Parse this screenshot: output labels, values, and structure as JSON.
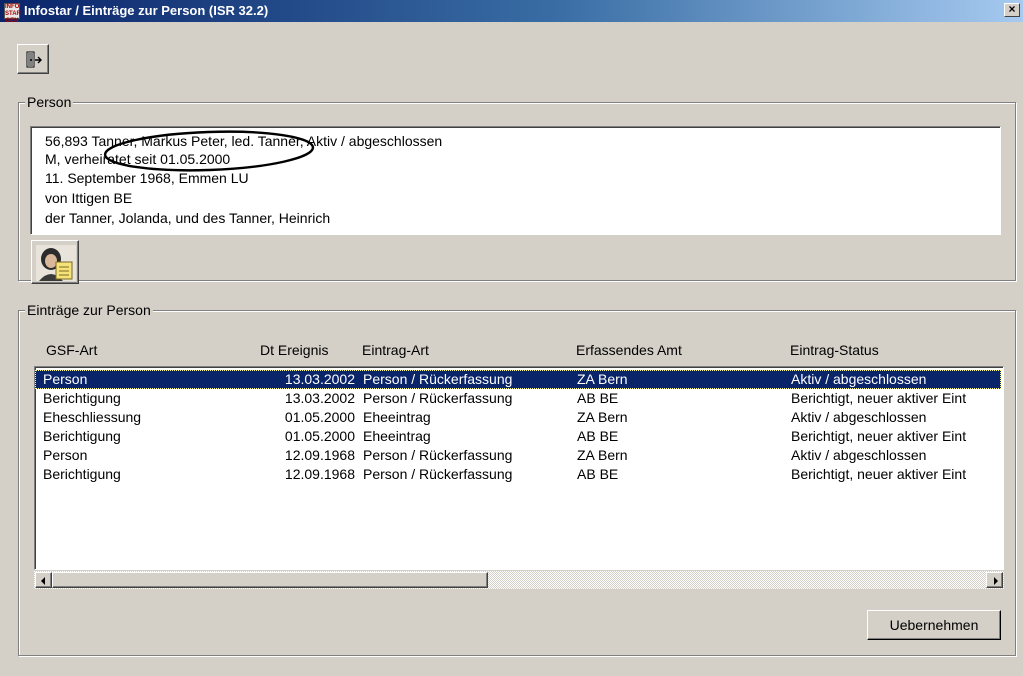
{
  "window": {
    "title": "Infostar / Einträge zur Person (ISR 32.2)",
    "icon_lines": [
      "INFO",
      "STAR",
      "GEN"
    ],
    "close_label": "×"
  },
  "toolbar": {
    "exit_icon": "door-exit-icon"
  },
  "person": {
    "group_label": "Person",
    "lines": [
      "56,893 Tanner, Markus Peter, led. Tanner, Aktiv / abgeschlossen",
      "M, verheiratet seit 01.05.2000",
      "11. September 1968, Emmen LU",
      "von Ittigen BE",
      "der Tanner, Jolanda, und des Tanner, Heinrich"
    ],
    "photo_icon": "person-photo-icon"
  },
  "eintraege": {
    "group_label": "Einträge zur Person",
    "columns": [
      "GSF-Art",
      "Dt Ereignis",
      "Eintrag-Art",
      "Erfassendes Amt",
      "Eintrag-Status"
    ],
    "rows": [
      [
        "Person",
        "13.03.2002",
        "Person / Rückerfassung",
        "ZA Bern",
        "Aktiv / abgeschlossen"
      ],
      [
        "Berichtigung",
        "13.03.2002",
        "Person / Rückerfassung",
        "AB BE",
        "Berichtigt, neuer aktiver Eint"
      ],
      [
        "Eheschliessung",
        "01.05.2000",
        "Eheeintrag",
        "ZA Bern",
        "Aktiv / abgeschlossen"
      ],
      [
        "Berichtigung",
        "01.05.2000",
        "Eheeintrag",
        "AB BE",
        "Berichtigt, neuer aktiver Eint"
      ],
      [
        "Person",
        "12.09.1968",
        "Person / Rückerfassung",
        "ZA Bern",
        "Aktiv / abgeschlossen"
      ],
      [
        "Berichtigung",
        "12.09.1968",
        "Person / Rückerfassung",
        "AB BE",
        "Berichtigt, neuer aktiver Eint"
      ]
    ],
    "selected_row": 0
  },
  "actions": {
    "uebernehmen_label": "Uebernehmen"
  },
  "colors": {
    "selection": "#0a246a",
    "face": "#d4d0c8",
    "annotation": "#000000"
  }
}
